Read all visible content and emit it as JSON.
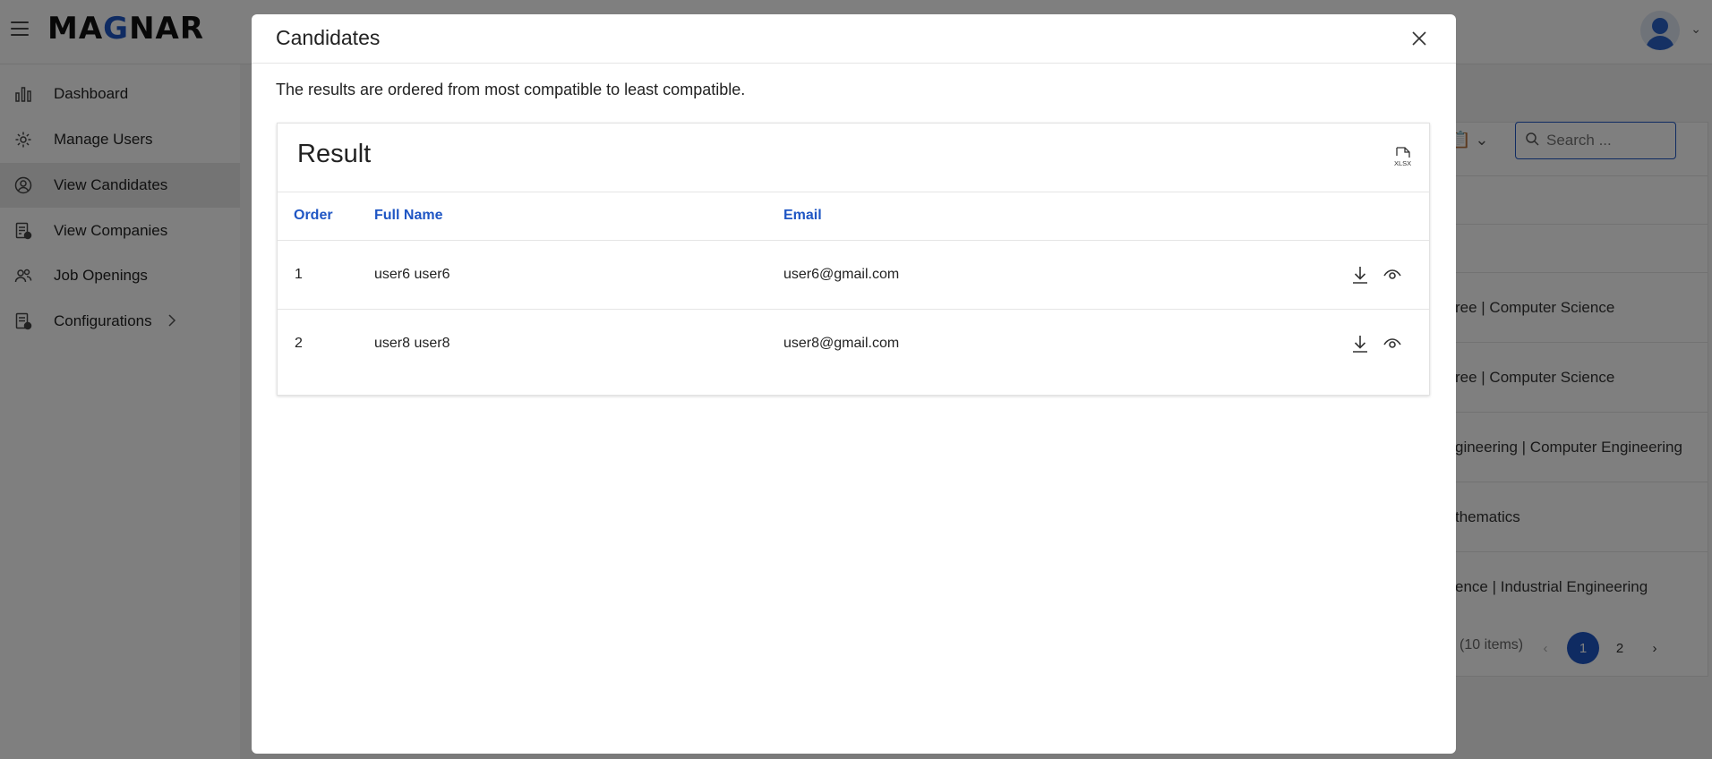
{
  "app": {
    "logo_text_1": "MA",
    "logo_text_g": "G",
    "logo_text_2": "NAR",
    "brand_color": "#1f56c4"
  },
  "sidebar": {
    "items": [
      {
        "label": "Dashboard",
        "icon": "bar-chart-icon"
      },
      {
        "label": "Manage Users",
        "icon": "gear-icon"
      },
      {
        "label": "View Candidates",
        "icon": "user-circle-icon",
        "active": true
      },
      {
        "label": "View Companies",
        "icon": "document-check-icon"
      },
      {
        "label": "Job Openings",
        "icon": "users-icon"
      },
      {
        "label": "Configurations",
        "icon": "document-gear-icon",
        "has_submenu": true
      }
    ]
  },
  "background": {
    "search_placeholder": "Search ...",
    "rows": [
      "ree | Computer Science",
      "ree | Computer Science",
      "gineering | Computer Engineering",
      "thematics",
      "ence | Industrial Engineering"
    ],
    "items_count": "(10 items)",
    "pages": [
      "1",
      "2"
    ],
    "current_page": "1"
  },
  "modal": {
    "title": "Candidates",
    "description": "The results are ordered from most compatible to least compatible.",
    "result": {
      "title": "Result",
      "export_icon": "xlsx-export-icon",
      "columns": [
        "Order",
        "Full Name",
        "Email"
      ],
      "rows": [
        {
          "order": "1",
          "full_name": "user6 user6",
          "email": "user6@gmail.com"
        },
        {
          "order": "2",
          "full_name": "user8 user8",
          "email": "user8@gmail.com"
        }
      ]
    }
  }
}
